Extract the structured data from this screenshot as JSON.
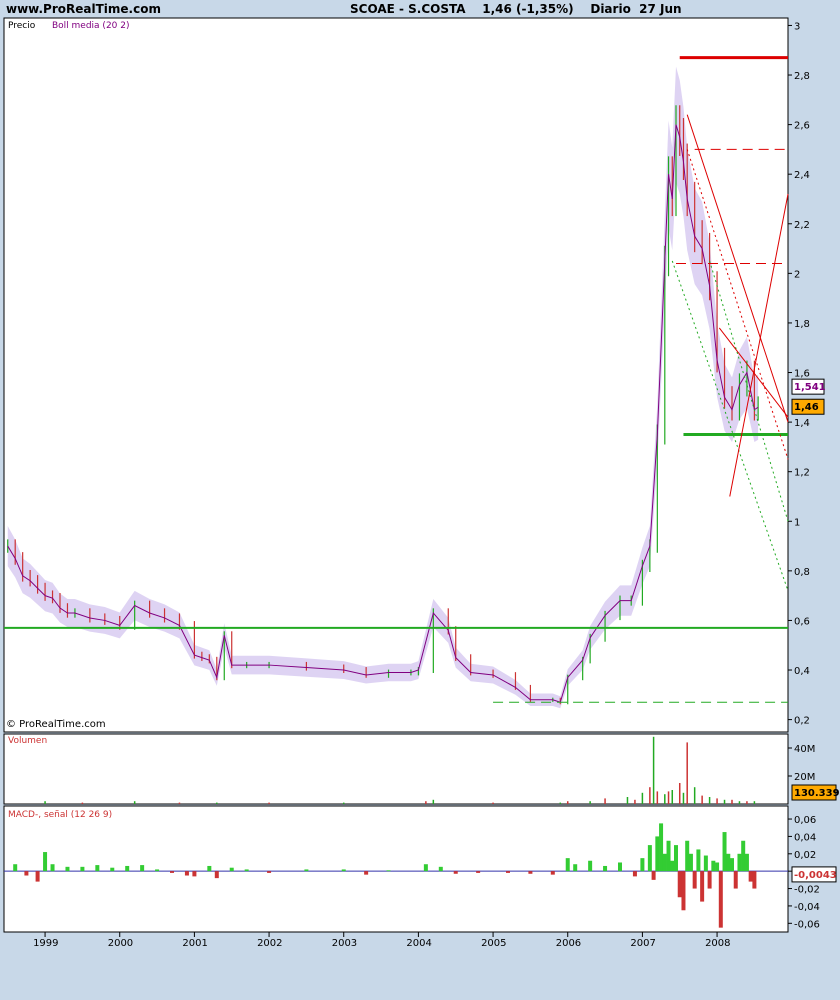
{
  "header": {
    "site": "www.ProRealTime.com",
    "instrument": "SCOAE - S.COSTA",
    "last": "1,46 (-1,35%)",
    "period": "Diario",
    "date": "27 Jun"
  },
  "watermark": "© ProRealTime.com",
  "chart_data": [
    {
      "type": "line",
      "panel": "price",
      "labels": {
        "price": "Precio",
        "indicator": "Boll media (20 2)"
      },
      "yticks": [
        "3",
        "2,8",
        "2,6",
        "2,4",
        "2,2",
        "2",
        "1,8",
        "1,6",
        "1,4",
        "1,2",
        "1",
        "0,8",
        "0,6",
        "0,4",
        "0,2"
      ],
      "ylim": [
        0.15,
        3.03
      ],
      "badges": {
        "boll": "1,541",
        "last": "1,46"
      },
      "colors": {
        "up": "#22aa22",
        "down": "#cc3333",
        "boll_band": "#d6c8f0",
        "boll_mid": "#800080",
        "support": "#22aa22",
        "resistance": "#dd0000"
      },
      "series": [
        {
          "x": [
            1998.5,
            1998.6,
            1998.7,
            1998.8,
            1998.9,
            1999.0,
            1999.1,
            1999.2,
            1999.3,
            1999.4,
            1999.6,
            1999.8,
            2000.0,
            2000.2,
            2000.4,
            2000.6,
            2000.8,
            2001.0,
            2001.1,
            2001.2,
            2001.3,
            2001.4,
            2001.5,
            2001.7,
            2002.0,
            2002.5,
            2003.0,
            2003.3,
            2003.6,
            2003.9,
            2004.0,
            2004.2,
            2004.4,
            2004.5,
            2004.7,
            2005.0,
            2005.3,
            2005.5,
            2005.8,
            2005.9,
            2006.0,
            2006.2,
            2006.3,
            2006.5,
            2006.7,
            2006.85,
            2007.0,
            2007.1,
            2007.2,
            2007.3,
            2007.35,
            2007.4,
            2007.45,
            2007.5,
            2007.55,
            2007.6,
            2007.7,
            2007.8,
            2007.9,
            2008.0,
            2008.1,
            2008.2,
            2008.3,
            2008.4,
            2008.5,
            2008.55
          ],
          "values": [
            0.9,
            0.85,
            0.78,
            0.76,
            0.73,
            0.7,
            0.69,
            0.65,
            0.63,
            0.63,
            0.61,
            0.6,
            0.58,
            0.66,
            0.63,
            0.61,
            0.58,
            0.46,
            0.45,
            0.44,
            0.37,
            0.54,
            0.42,
            0.42,
            0.42,
            0.41,
            0.4,
            0.38,
            0.39,
            0.39,
            0.4,
            0.63,
            0.56,
            0.45,
            0.39,
            0.38,
            0.33,
            0.28,
            0.28,
            0.27,
            0.37,
            0.44,
            0.53,
            0.62,
            0.68,
            0.68,
            0.82,
            0.9,
            1.35,
            2.05,
            2.4,
            2.3,
            2.6,
            2.55,
            2.45,
            2.3,
            2.15,
            2.1,
            1.95,
            1.65,
            1.5,
            1.45,
            1.55,
            1.6,
            1.45,
            1.46
          ]
        }
      ],
      "levels": [
        {
          "value": 2.87,
          "x_from": 2007.5,
          "x_to": 2008.95,
          "color": "red",
          "style": "solid"
        },
        {
          "value": 2.5,
          "x_from": 2007.7,
          "x_to": 2008.95,
          "color": "red",
          "style": "dashed"
        },
        {
          "value": 2.04,
          "x_from": 2007.45,
          "x_to": 2008.95,
          "color": "red",
          "style": "dashed"
        },
        {
          "value": 1.35,
          "x_from": 2007.55,
          "x_to": 2008.95,
          "color": "green",
          "style": "solid"
        },
        {
          "value": 0.57,
          "x_from": 1998.45,
          "x_to": 2008.95,
          "color": "green",
          "style": "solid"
        },
        {
          "value": 0.27,
          "x_from": 2005.0,
          "x_to": 2008.95,
          "color": "green",
          "style": "dashed"
        }
      ],
      "trendlines": [
        {
          "x1": 2007.6,
          "y1": 2.64,
          "x2": 2008.95,
          "y2": 1.4,
          "color": "red",
          "style": "solid"
        },
        {
          "x1": 2007.6,
          "y1": 2.5,
          "x2": 2008.95,
          "y2": 1.25,
          "color": "red",
          "style": "dotted"
        },
        {
          "x1": 2007.4,
          "y1": 2.05,
          "x2": 2008.95,
          "y2": 0.72,
          "color": "green",
          "style": "dotted"
        },
        {
          "x1": 2007.9,
          "y1": 2.05,
          "x2": 2008.95,
          "y2": 1.0,
          "color": "green",
          "style": "dotted"
        },
        {
          "x1": 2008.17,
          "y1": 1.1,
          "x2": 2008.95,
          "y2": 2.32,
          "color": "red",
          "style": "solid"
        },
        {
          "x1": 2008.03,
          "y1": 1.78,
          "x2": 2008.95,
          "y2": 1.42,
          "color": "red",
          "style": "solid"
        }
      ]
    },
    {
      "type": "bar",
      "panel": "volume",
      "label": "Volumen",
      "yticks": [
        "40M",
        "20M"
      ],
      "ylim": [
        0,
        50
      ],
      "badge": "130.339",
      "x": [
        1999.0,
        1999.5,
        2000.2,
        2000.8,
        2001.3,
        2002.0,
        2003.0,
        2004.1,
        2004.2,
        2005.0,
        2005.9,
        2006.0,
        2006.3,
        2006.5,
        2006.8,
        2006.9,
        2007.0,
        2007.1,
        2007.15,
        2007.2,
        2007.3,
        2007.35,
        2007.4,
        2007.5,
        2007.55,
        2007.6,
        2007.7,
        2007.8,
        2007.9,
        2008.0,
        2008.1,
        2008.2,
        2008.3,
        2008.4,
        2008.5
      ],
      "values": [
        2,
        1,
        2,
        1,
        1,
        1,
        1,
        2,
        3,
        1,
        1,
        2,
        2,
        4,
        5,
        3,
        8,
        12,
        48,
        9,
        7,
        9,
        10,
        15,
        8,
        44,
        12,
        6,
        5,
        4,
        3,
        3,
        2,
        2,
        2
      ]
    },
    {
      "type": "bar",
      "panel": "macd",
      "label": "MACD-, señal (12 26 9)",
      "yticks": [
        "0,06",
        "0,04",
        "0,02",
        "0",
        "-0,02",
        "-0,04",
        "-0,06"
      ],
      "ylim": [
        -0.07,
        0.075
      ],
      "badge": "-0,0043",
      "x": [
        1998.6,
        1998.75,
        1998.9,
        1999.0,
        1999.1,
        1999.3,
        1999.5,
        1999.7,
        1999.9,
        2000.1,
        2000.3,
        2000.5,
        2000.7,
        2000.9,
        2001.0,
        2001.2,
        2001.3,
        2001.5,
        2001.7,
        2002.0,
        2002.5,
        2003.0,
        2003.3,
        2003.6,
        2004.1,
        2004.3,
        2004.5,
        2004.8,
        2005.2,
        2005.5,
        2005.8,
        2006.0,
        2006.1,
        2006.3,
        2006.5,
        2006.7,
        2006.9,
        2007.0,
        2007.1,
        2007.15,
        2007.2,
        2007.25,
        2007.3,
        2007.35,
        2007.4,
        2007.45,
        2007.5,
        2007.55,
        2007.6,
        2007.65,
        2007.7,
        2007.75,
        2007.8,
        2007.85,
        2007.9,
        2007.95,
        2008.0,
        2008.05,
        2008.1,
        2008.15,
        2008.2,
        2008.25,
        2008.3,
        2008.35,
        2008.4,
        2008.45,
        2008.5
      ],
      "values": [
        0.008,
        -0.005,
        -0.012,
        0.022,
        0.008,
        0.005,
        0.005,
        0.007,
        0.004,
        0.006,
        0.007,
        0.002,
        -0.002,
        -0.005,
        -0.006,
        0.006,
        -0.008,
        0.004,
        0.002,
        -0.002,
        0.002,
        0.002,
        -0.004,
        0.001,
        0.008,
        0.005,
        -0.003,
        -0.002,
        -0.002,
        -0.003,
        -0.004,
        0.015,
        0.008,
        0.012,
        0.006,
        0.01,
        -0.006,
        0.015,
        0.03,
        -0.01,
        0.04,
        0.055,
        0.02,
        0.035,
        0.012,
        0.03,
        -0.03,
        -0.045,
        0.035,
        0.02,
        -0.02,
        0.025,
        -0.035,
        0.018,
        -0.02,
        0.012,
        0.01,
        -0.065,
        0.045,
        0.02,
        0.015,
        -0.02,
        0.02,
        0.035,
        0.02,
        -0.012,
        -0.02
      ]
    }
  ],
  "xaxis": {
    "years": [
      "1999",
      "2000",
      "2001",
      "2002",
      "2003",
      "2004",
      "2005",
      "2006",
      "2007",
      "2008"
    ]
  }
}
